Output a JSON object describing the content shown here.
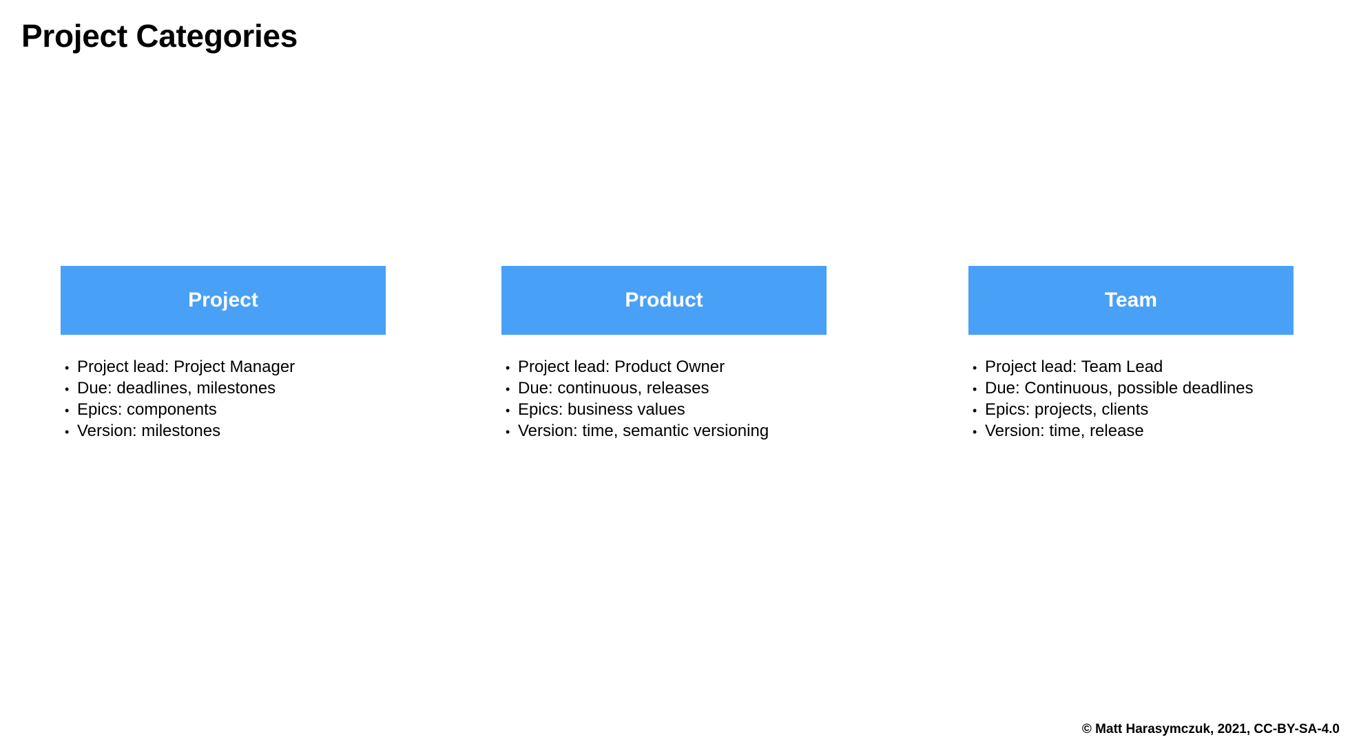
{
  "page": {
    "title": "Project Categories",
    "copyright": "© Matt Harasymczuk, 2021, CC-BY-SA-4.0"
  },
  "colors": {
    "header_background": "#49a0f7",
    "header_text": "#ffffff",
    "body_text": "#000000"
  },
  "categories": [
    {
      "name": "Project",
      "items": [
        "Project lead: Project Manager",
        "Due: deadlines, milestones",
        "Epics: components",
        "Version: milestones"
      ]
    },
    {
      "name": "Product",
      "items": [
        "Project lead: Product Owner",
        "Due: continuous, releases",
        "Epics: business values",
        "Version: time, semantic versioning"
      ]
    },
    {
      "name": "Team",
      "items": [
        "Project lead: Team Lead",
        "Due: Continuous, possible deadlines",
        "Epics: projects, clients",
        "Version: time, release"
      ]
    }
  ]
}
